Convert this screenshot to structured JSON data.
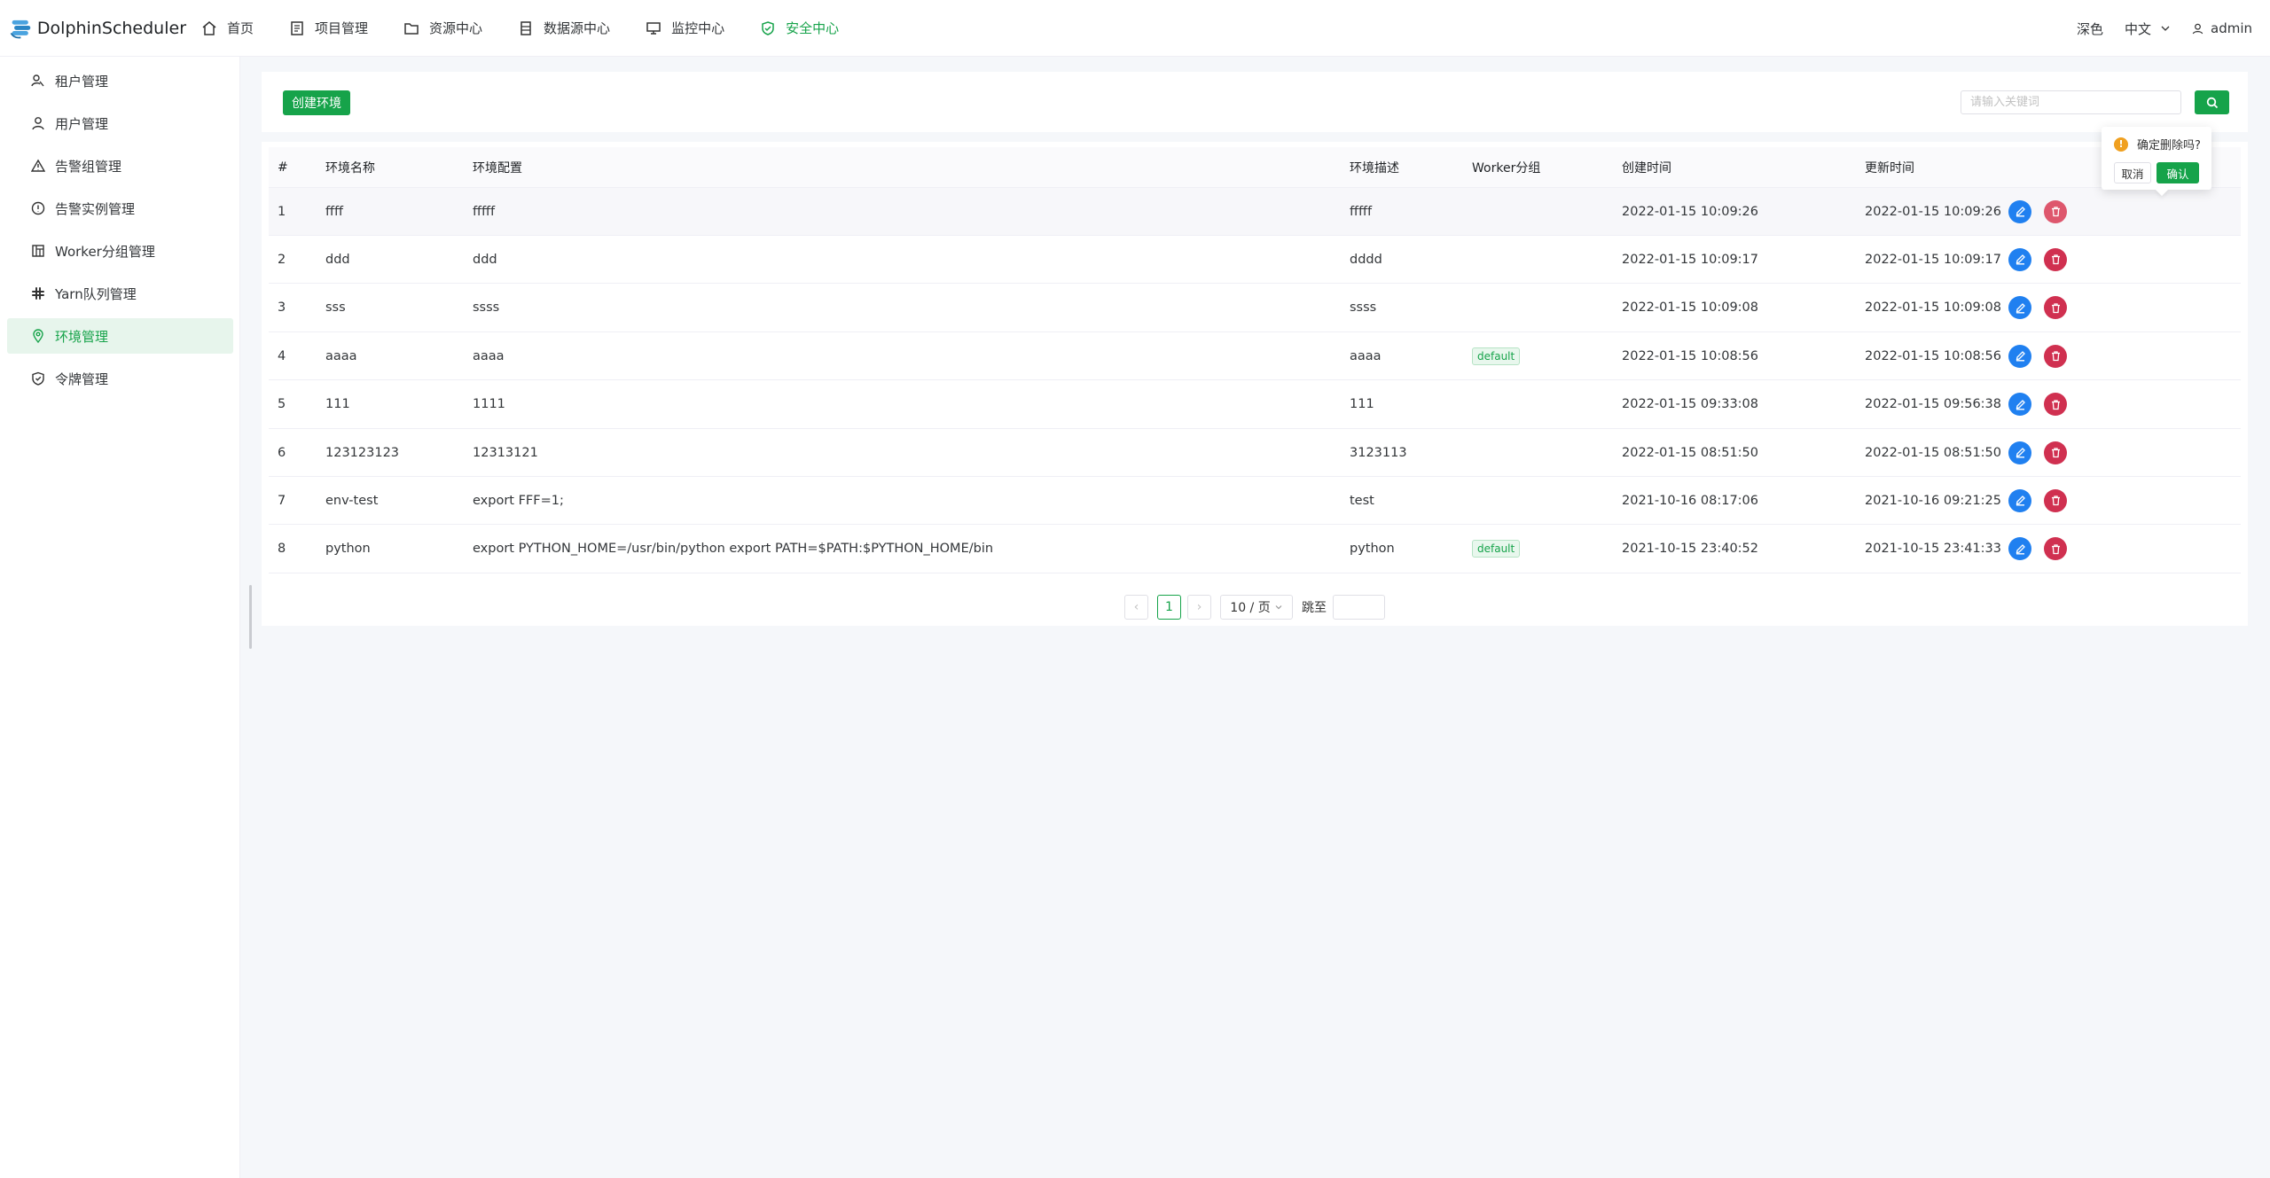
{
  "app": {
    "name": "DolphinScheduler"
  },
  "nav": [
    {
      "label": "首页",
      "icon": "home-icon"
    },
    {
      "label": "项目管理",
      "icon": "project-icon"
    },
    {
      "label": "资源中心",
      "icon": "folder-icon"
    },
    {
      "label": "数据源中心",
      "icon": "database-icon"
    },
    {
      "label": "监控中心",
      "icon": "monitor-icon"
    },
    {
      "label": "安全中心",
      "icon": "shield-icon",
      "active": true
    }
  ],
  "header_right": {
    "theme": "深色",
    "language": "中文",
    "user": "admin"
  },
  "sidebar": [
    {
      "label": "租户管理",
      "icon": "tenant-icon"
    },
    {
      "label": "用户管理",
      "icon": "user-icon"
    },
    {
      "label": "告警组管理",
      "icon": "warning-icon"
    },
    {
      "label": "告警实例管理",
      "icon": "info-circle-icon"
    },
    {
      "label": "Worker分组管理",
      "icon": "grid-icon"
    },
    {
      "label": "Yarn队列管理",
      "icon": "slack-icon"
    },
    {
      "label": "环境管理",
      "icon": "location-icon",
      "active": true
    },
    {
      "label": "令牌管理",
      "icon": "shield-check-icon"
    }
  ],
  "toolbar": {
    "create_label": "创建环境",
    "search_placeholder": "请输入关键词",
    "search_value": ""
  },
  "table": {
    "headers": [
      "#",
      "环境名称",
      "环境配置",
      "环境描述",
      "Worker分组",
      "创建时间",
      "更新时间"
    ],
    "rows": [
      {
        "index": "1",
        "name": "ffff",
        "config": "fffff",
        "desc": "fffff",
        "worker_group": "",
        "created": "2022-01-15 10:09:26",
        "updated": "2022-01-15 10:09:26"
      },
      {
        "index": "2",
        "name": "ddd",
        "config": "ddd",
        "desc": "dddd",
        "worker_group": "",
        "created": "2022-01-15 10:09:17",
        "updated": "2022-01-15 10:09:17"
      },
      {
        "index": "3",
        "name": "sss",
        "config": "ssss",
        "desc": "ssss",
        "worker_group": "",
        "created": "2022-01-15 10:09:08",
        "updated": "2022-01-15 10:09:08"
      },
      {
        "index": "4",
        "name": "aaaa",
        "config": "aaaa",
        "desc": "aaaa",
        "worker_group": "default",
        "created": "2022-01-15 10:08:56",
        "updated": "2022-01-15 10:08:56"
      },
      {
        "index": "5",
        "name": "111",
        "config": "1111",
        "desc": "111",
        "worker_group": "",
        "created": "2022-01-15 09:33:08",
        "updated": "2022-01-15 09:56:38"
      },
      {
        "index": "6",
        "name": "123123123",
        "config": "12313121",
        "desc": "3123113",
        "worker_group": "",
        "created": "2022-01-15 08:51:50",
        "updated": "2022-01-15 08:51:50"
      },
      {
        "index": "7",
        "name": "env-test",
        "config": "export FFF=1;",
        "desc": "test",
        "worker_group": "",
        "created": "2021-10-16 08:17:06",
        "updated": "2021-10-16 09:21:25"
      },
      {
        "index": "8",
        "name": "python",
        "config": "export PYTHON_HOME=/usr/bin/python export PATH=$PATH:$PYTHON_HOME/bin",
        "desc": "python",
        "worker_group": "default",
        "created": "2021-10-15 23:40:52",
        "updated": "2021-10-15 23:41:33"
      }
    ]
  },
  "pagination": {
    "prev": "‹",
    "page": "1",
    "next": "›",
    "page_size": "10 / 页",
    "jump_label": "跳至"
  },
  "popconfirm": {
    "message": "确定删除吗?",
    "cancel": "取消",
    "confirm": "确认"
  },
  "colors": {
    "primary": "#16a34a",
    "edit": "#2080f0",
    "delete": "#d03050",
    "warning": "#f0a020"
  }
}
